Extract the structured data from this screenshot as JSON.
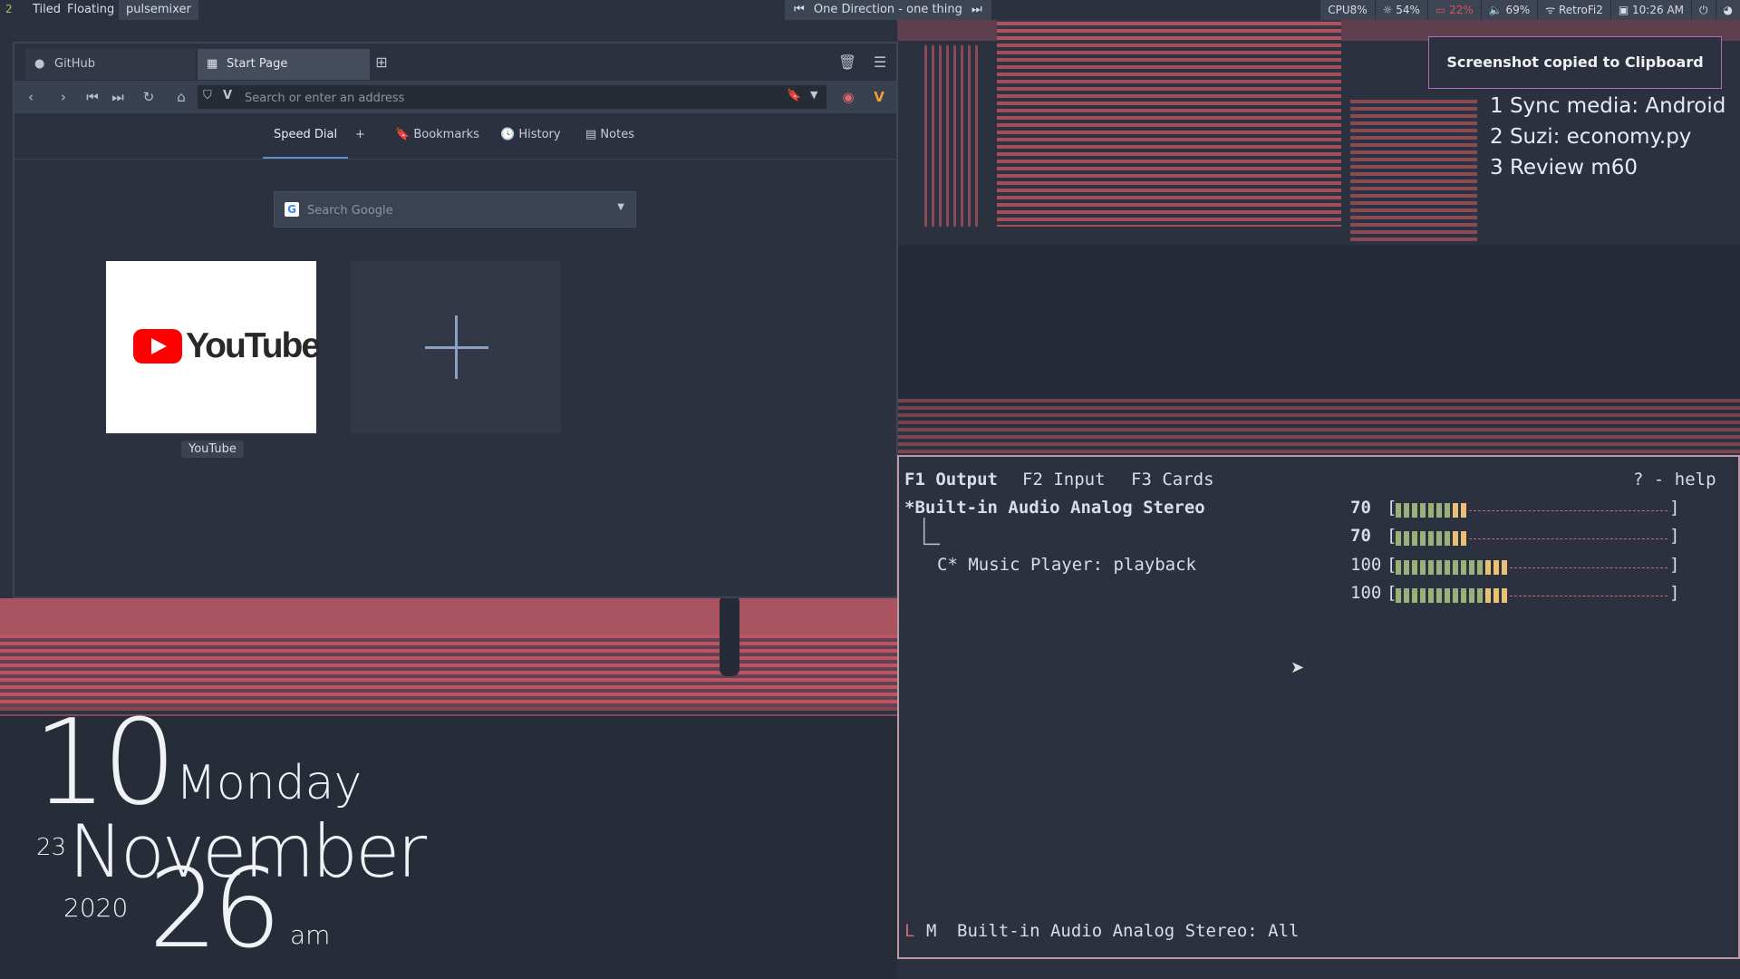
{
  "topbar": {
    "workspace": "2",
    "tiled": "Tiled",
    "floating": "Floating",
    "window_title": "pulsemixer",
    "media_track": "One Direction - one thing",
    "cpu": "CPU8%",
    "brightness": "54%",
    "battery": "22%",
    "volume": "69%",
    "wifi": "RetroFi2",
    "clock": "10:26 AM"
  },
  "browser": {
    "tabs": [
      {
        "label": "GitHub",
        "active": false
      },
      {
        "label": "Start Page",
        "active": true
      }
    ],
    "address_placeholder": "Search or enter an address",
    "speed_dial_nav": [
      "Speed Dial",
      "+",
      "Bookmarks",
      "History",
      "Notes"
    ],
    "search_placeholder": "Search Google",
    "dials": [
      {
        "label": "YouTube",
        "logo_text": "YouTube"
      }
    ]
  },
  "notification": "Screenshot copied to Clipboard",
  "todo": [
    "1 Sync media: Android",
    "2 Suzi: economy.py",
    "3 Review m60"
  ],
  "pulsemixer": {
    "tabs": [
      "F1 Output",
      "F2 Input",
      "F3 Cards"
    ],
    "help": "? - help",
    "devices": [
      {
        "name": "*Built-in Audio Analog Stereo",
        "left": "70",
        "right": "70"
      },
      {
        "name": "C* Music Player: playback",
        "left": "100",
        "right": "100"
      }
    ],
    "levels": [
      0.28,
      0.28,
      0.42,
      0.42
    ],
    "status_L": "L",
    "status_M": "M",
    "status_text": "Built-in Audio Analog Stereo: All"
  },
  "clock": {
    "hour": "10",
    "weekday": "Monday",
    "day": "23",
    "month": "November",
    "year": "2020",
    "minute": "26",
    "ampm": "am"
  },
  "colors": {
    "accent_green": "#9ab07a",
    "accent_yellow": "#e9c074",
    "warn_red": "#e0505a",
    "wall_red": "#c05866"
  }
}
